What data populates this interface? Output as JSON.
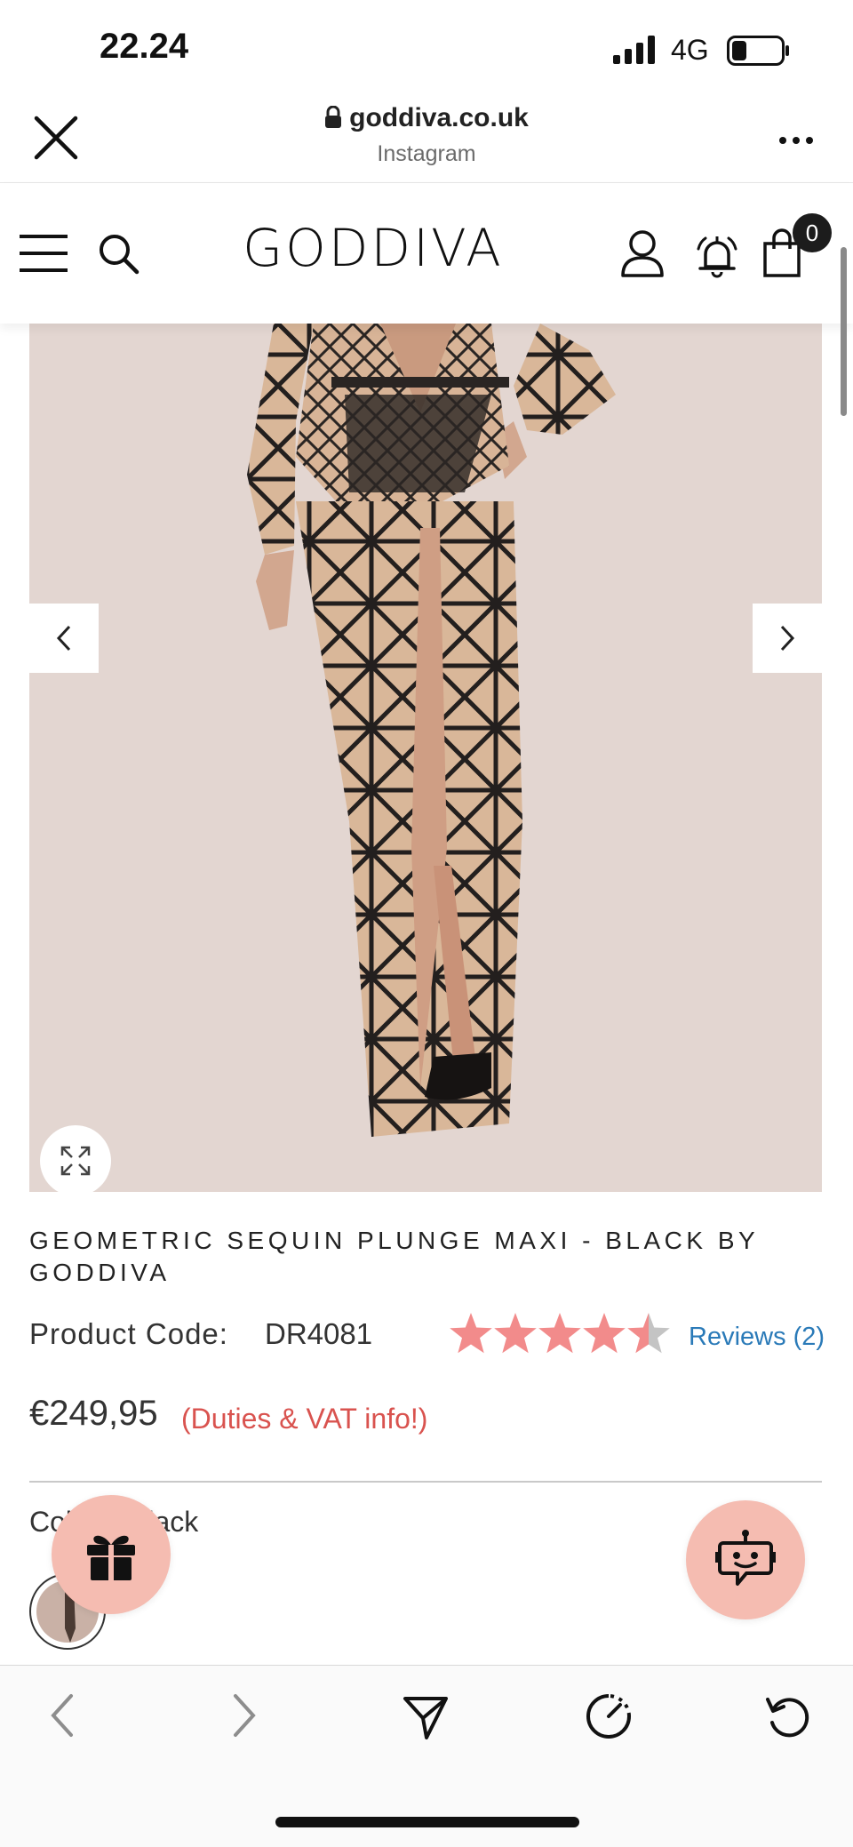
{
  "status_bar": {
    "time": "22.24",
    "network": "4G"
  },
  "browser": {
    "domain": "goddiva.co.uk",
    "source": "Instagram",
    "close_icon": "close-icon",
    "more_icon": "more-icon"
  },
  "site_header": {
    "logo_text": "GODDIVA",
    "cart_count": "0",
    "icons": [
      "menu-icon",
      "search-icon",
      "account-icon",
      "bell-icon",
      "bag-icon"
    ]
  },
  "product": {
    "title": "GEOMETRIC SEQUIN PLUNGE MAXI - BLACK BY GODDIVA",
    "code_label": "Product Code:",
    "code_value": "DR4081",
    "rating": 4.5,
    "rating_max": 5,
    "reviews_label": "Reviews (2)",
    "price": "€249,95",
    "duties_label": "(Duties & VAT info!)",
    "colour_label": "Colour: Black"
  },
  "colors": {
    "star": "#f28b8b",
    "star_empty": "#c4c4c4",
    "link": "#2a7ab8",
    "duties": "#d9534f",
    "floating_button": "#f5bcb1",
    "image_background": "#e3d6d1"
  }
}
